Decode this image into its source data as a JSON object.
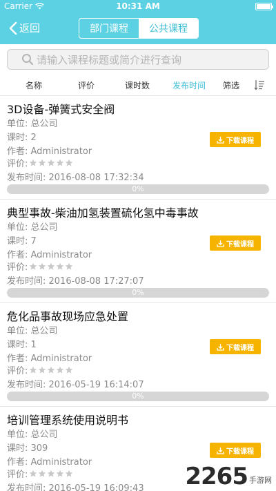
{
  "status": {
    "carrier": "Carrier",
    "time": "10:31 AM"
  },
  "nav": {
    "back_label": "返回",
    "tabs": [
      "部门课程",
      "公共课程"
    ],
    "active_tab": 1
  },
  "search": {
    "placeholder": "请输入课程标题或简介进行查询"
  },
  "sort": {
    "items": [
      "名称",
      "评价",
      "课时数",
      "发布时间",
      "筛选"
    ],
    "active": 3
  },
  "labels": {
    "unit": "单位: ",
    "hours": "课时: ",
    "author": "作者: ",
    "rating": "评价:",
    "published": "发布时间: ",
    "download": "下载课程"
  },
  "courses": [
    {
      "title": "3D设备-弹簧式安全阀",
      "unit": "总公司",
      "hours": "2",
      "author": "Administrator",
      "published": "2016-08-08 17:32:34",
      "progress": "0%"
    },
    {
      "title": "典型事故-柴油加氢装置硫化氢中毒事故",
      "unit": "总公司",
      "hours": "7",
      "author": "Administrator",
      "published": "2016-08-08 17:27:07",
      "progress": "0%"
    },
    {
      "title": "危化品事故现场应急处置",
      "unit": "总公司",
      "hours": "1",
      "author": "Administrator",
      "published": "2016-05-19 16:14:07",
      "progress": "0%"
    },
    {
      "title": "培训管理系统使用说明书",
      "unit": "总公司",
      "hours": "309",
      "author": "Administrator",
      "published": "2016-05-19 16:09:43",
      "progress": ""
    }
  ],
  "watermark": {
    "main": "2265",
    "suffix": ".com",
    "cn": "手游网"
  },
  "colors": {
    "accent": "#5cd1e3",
    "download": "#f6b400",
    "muted": "#8a8a8a"
  }
}
